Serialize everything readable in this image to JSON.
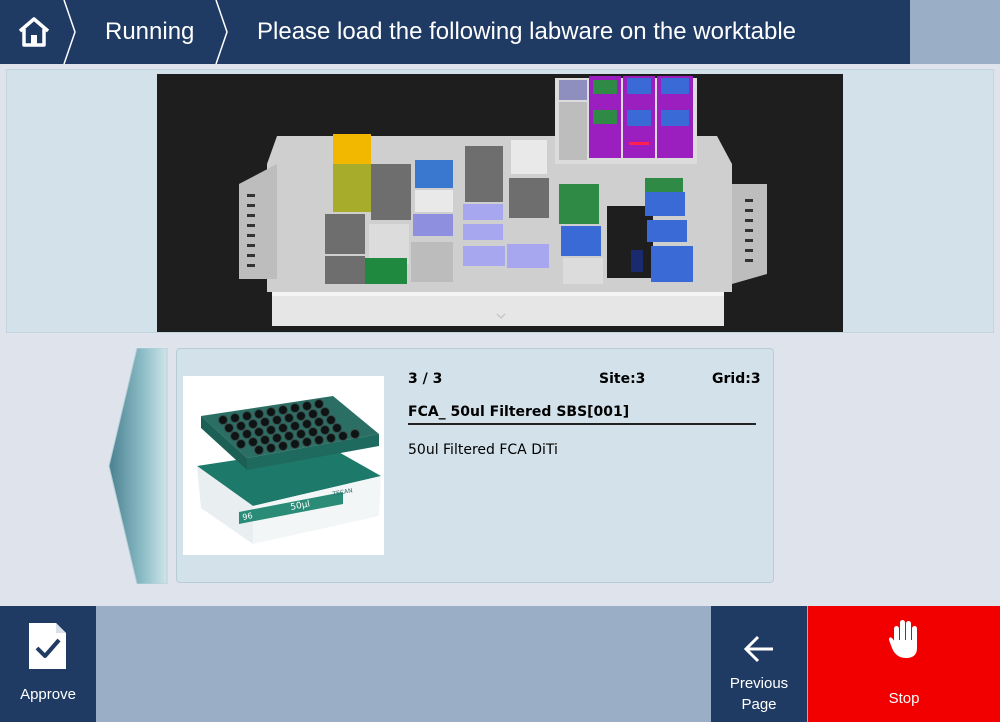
{
  "header": {
    "home_icon": "home-icon",
    "breadcrumb": [
      "Running",
      "Please load the following labware on the worktable"
    ]
  },
  "worktable": {
    "view": "3d-worktable-render"
  },
  "labware": {
    "position": "3 / 3",
    "site": "Site:3",
    "grid": "Grid:3",
    "name": "FCA_ 50ul Filtered SBS[001]",
    "description": "50ul Filtered FCA DiTi",
    "photo_label_left": "96",
    "photo_label_right": "50µl",
    "photo_brand": "TECAN"
  },
  "footer": {
    "approve_label": "Approve",
    "previous_label_line1": "Previous",
    "previous_label_line2": "Page",
    "stop_label": "Stop"
  },
  "colors": {
    "header_bg": "#1f3a63",
    "panel_bg": "#d3e2ea",
    "footer_bg": "#9aafc6",
    "stop_bg": "#f20000"
  }
}
